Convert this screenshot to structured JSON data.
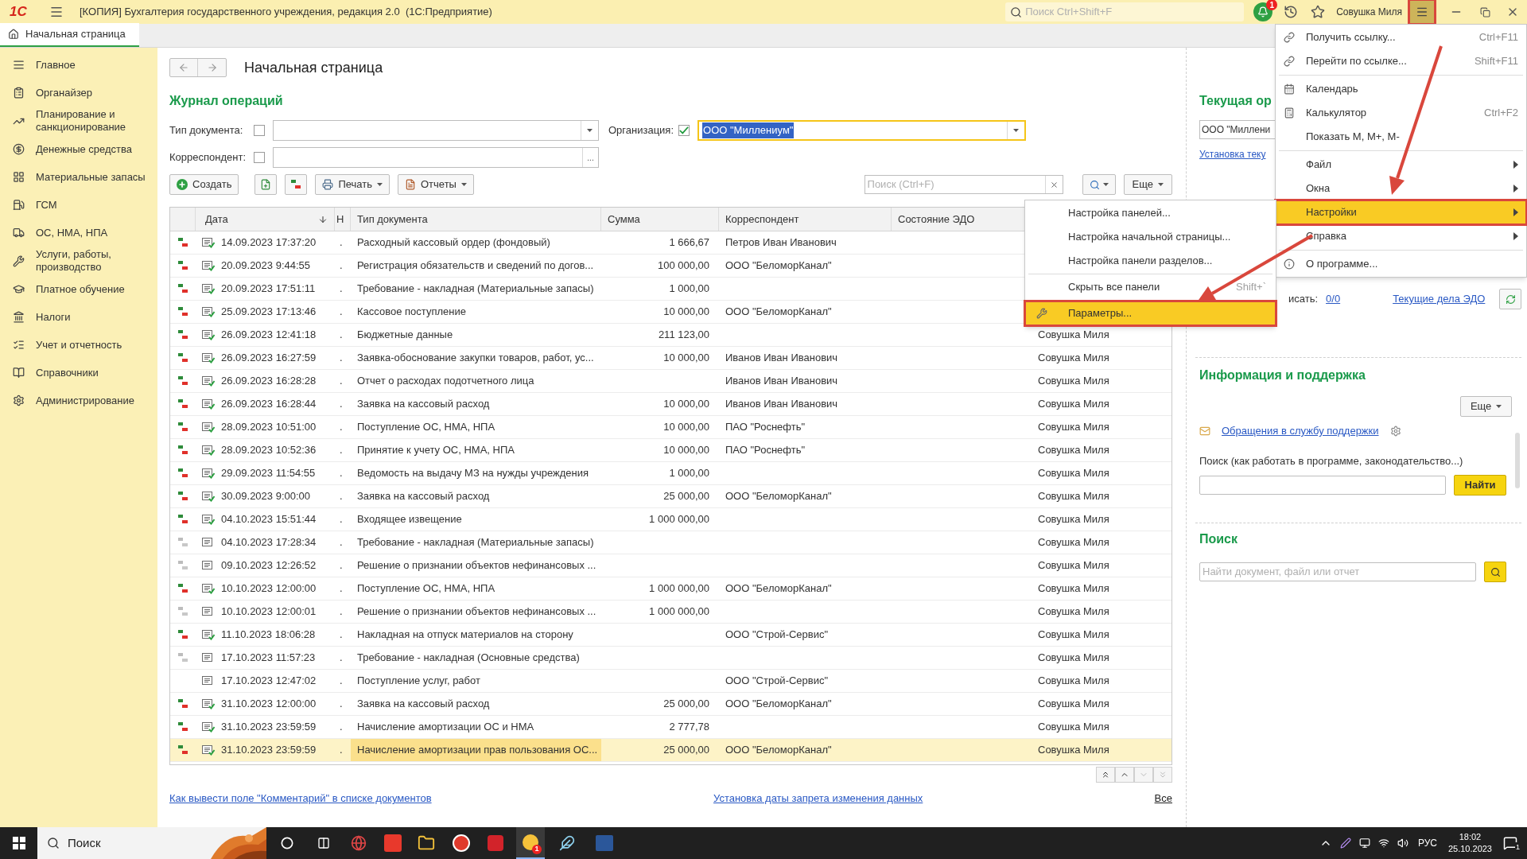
{
  "title_bar": {
    "logo": "1С",
    "title": "[КОПИЯ] Бухгалтерия государственного учреждения, редакция 2.0  (1С:Предприятие)",
    "search_placeholder": "Поиск Ctrl+Shift+F",
    "notifications": "1",
    "user": "Совушка Миля",
    "menu_highlighted": true
  },
  "tabs": [
    {
      "label": "Начальная страница",
      "selected": true
    }
  ],
  "sidebar": {
    "items": [
      {
        "label": "Главное"
      },
      {
        "label": "Органайзер"
      },
      {
        "label": "Планирование и санкционирование"
      },
      {
        "label": "Денежные средства"
      },
      {
        "label": "Материальные запасы"
      },
      {
        "label": "ГСМ"
      },
      {
        "label": "ОС, НМА, НПА"
      },
      {
        "label": "Услуги, работы, производство"
      },
      {
        "label": "Платное обучение"
      },
      {
        "label": "Налоги"
      },
      {
        "label": "Учет и отчетность"
      },
      {
        "label": "Справочники"
      },
      {
        "label": "Администрирование"
      }
    ]
  },
  "page": {
    "title": "Начальная страница"
  },
  "journal": {
    "title": "Журнал операций",
    "filters": [
      {
        "label": "Тип документа:",
        "checked": false,
        "kind": "combo"
      },
      {
        "label": "Организация:",
        "checked": true,
        "value": "ООО \"Миллениум\"",
        "kind": "combo"
      },
      {
        "label": "Корреспондент:",
        "checked": false,
        "kind": "choice",
        "button": "..."
      }
    ],
    "toolbar": {
      "create": "Создать",
      "print": "Печать",
      "reports": "Отчеты",
      "search_placeholder": "Поиск (Ctrl+F)",
      "more": "Еще"
    },
    "table": {
      "columns": [
        "Дата",
        "Н",
        "Тип документа",
        "Сумма",
        "Корреспондент",
        "Состояние ЭДО"
      ],
      "rows": [
        {
          "kind": "posted",
          "date": "14.09.2023 17:37:20",
          "n": ".",
          "type": "Расходный кассовый ордер (фондовый)",
          "sum": "1 666,67",
          "correspondent": "Петров Иван Иванович",
          "selected": false
        },
        {
          "kind": "posted",
          "date": "20.09.2023 9:44:55",
          "n": ".",
          "type": "Регистрация обязательств и сведений по догов...",
          "sum": "100 000,00",
          "correspondent": "ООО \"БеломорКанал\"",
          "selected": false
        },
        {
          "kind": "posted",
          "date": "20.09.2023 17:51:11",
          "n": ".",
          "type": "Требование - накладная (Материальные запасы)",
          "sum": "1 000,00",
          "selected": false
        },
        {
          "kind": "posted",
          "date": "25.09.2023 17:13:46",
          "n": ".",
          "type": "Кассовое поступление",
          "sum": "10 000,00",
          "correspondent": "ООО \"БеломорКанал\"",
          "selected": false
        },
        {
          "kind": "posted",
          "date": "26.09.2023 12:41:18",
          "n": ".",
          "type": "Бюджетные данные",
          "sum": "211 123,00",
          "responsible": "Совушка Миля",
          "selected": false
        },
        {
          "kind": "posted",
          "date": "26.09.2023 16:27:59",
          "n": ".",
          "type": "Заявка-обоснование закупки товаров, работ, ус...",
          "sum": "10 000,00",
          "correspondent": "Иванов Иван Иванович",
          "responsible": "Совушка Миля",
          "selected": false
        },
        {
          "kind": "posted",
          "date": "26.09.2023 16:28:28",
          "n": ".",
          "type": "Отчет о расходах подотчетного лица",
          "correspondent": "Иванов Иван Иванович",
          "responsible": "Совушка Миля",
          "selected": false
        },
        {
          "kind": "posted",
          "date": "26.09.2023 16:28:44",
          "n": ".",
          "type": "Заявка на кассовый расход",
          "sum": "10 000,00",
          "correspondent": "Иванов Иван Иванович",
          "responsible": "Совушка Миля",
          "selected": false
        },
        {
          "kind": "posted",
          "date": "28.09.2023 10:51:00",
          "n": ".",
          "type": "Поступление ОС, НМА, НПА",
          "sum": "10 000,00",
          "correspondent": "ПАО \"Роснефть\"",
          "responsible": "Совушка Миля",
          "selected": false
        },
        {
          "kind": "posted",
          "date": "28.09.2023 10:52:36",
          "n": ".",
          "type": "Принятие к учету ОС, НМА, НПА",
          "sum": "10 000,00",
          "correspondent": "ПАО \"Роснефть\"",
          "responsible": "Совушка Миля",
          "selected": false
        },
        {
          "kind": "posted",
          "date": "29.09.2023 11:54:55",
          "n": ".",
          "type": "Ведомость на выдачу МЗ на нужды учреждения",
          "sum": "1 000,00",
          "responsible": "Совушка Миля",
          "selected": false
        },
        {
          "kind": "posted",
          "date": "30.09.2023 9:00:00",
          "n": ".",
          "type": "Заявка на кассовый расход",
          "sum": "25 000,00",
          "correspondent": "ООО \"БеломорКанал\"",
          "responsible": "Совушка Миля",
          "selected": false
        },
        {
          "kind": "posted",
          "date": "04.10.2023 15:51:44",
          "n": ".",
          "type": "Входящее извещение",
          "sum": "1 000 000,00",
          "responsible": "Совушка Миля",
          "selected": false
        },
        {
          "kind": "unposted",
          "date": "04.10.2023 17:28:34",
          "n": ".",
          "type": "Требование - накладная (Материальные запасы)",
          "responsible": "Совушка Миля",
          "selected": false
        },
        {
          "kind": "unposted",
          "date": "09.10.2023 12:26:52",
          "n": ".",
          "type": "Решение о признании объектов нефинансовых ...",
          "responsible": "Совушка Миля",
          "selected": false
        },
        {
          "kind": "posted",
          "date": "10.10.2023 12:00:00",
          "n": ".",
          "type": "Поступление ОС, НМА, НПА",
          "sum": "1 000 000,00",
          "correspondent": "ООО \"БеломорКанал\"",
          "responsible": "Совушка Миля",
          "selected": false
        },
        {
          "kind": "unposted",
          "date": "10.10.2023 12:00:01",
          "n": ".",
          "type": "Решение о признании объектов нефинансовых ...",
          "sum": "1 000 000,00",
          "responsible": "Совушка Миля",
          "selected": false
        },
        {
          "kind": "posted",
          "date": "11.10.2023 18:06:28",
          "n": ".",
          "type": "Накладная на отпуск материалов на сторону",
          "correspondent": "ООО \"Строй-Сервис\"",
          "responsible": "Совушка Миля",
          "selected": false
        },
        {
          "kind": "unposted",
          "date": "17.10.2023 11:57:23",
          "n": ".",
          "type": "Требование - накладная (Основные средства)",
          "responsible": "Совушка Миля",
          "selected": false
        },
        {
          "kind": "none",
          "date": "17.10.2023 12:47:02",
          "n": ".",
          "type": "Поступление услуг, работ",
          "correspondent": "ООО \"Строй-Сервис\"",
          "responsible": "Совушка Миля",
          "selected": false
        },
        {
          "kind": "posted",
          "date": "31.10.2023 12:00:00",
          "n": ".",
          "type": "Заявка на кассовый расход",
          "sum": "25 000,00",
          "correspondent": "ООО \"БеломорКанал\"",
          "responsible": "Совушка Миля",
          "selected": false
        },
        {
          "kind": "posted",
          "date": "31.10.2023 23:59:59",
          "n": ".",
          "type": "Начисление амортизации ОС и НМА",
          "sum": "2 777,78",
          "responsible": "Совушка Миля",
          "selected": false
        },
        {
          "kind": "posted",
          "date": "31.10.2023 23:59:59",
          "n": ".",
          "type": "Начисление амортизации прав пользования ОС...",
          "sum": "25 000,00",
          "correspondent": "ООО \"БеломорКанал\"",
          "responsible": "Совушка Миля",
          "selected": true
        }
      ]
    },
    "links": [
      "Как вывести поле \"Комментарий\" в списке документов",
      "Установка даты запрета изменения данных",
      "Все"
    ]
  },
  "right_panel": {
    "org_title": "Текущая ор",
    "org_value": "ООО \"Миллени",
    "org_link": "Установка теку",
    "sign_label": "исать:",
    "sign_count": "0/0",
    "edo_link": "Текущие дела ЭДО",
    "support_title": "Информация и поддержка",
    "more": "Еще",
    "support_link": "Обращения в службу поддержки",
    "help_label": "Поиск (как работать в программе, законодательство...)",
    "find": "Найти",
    "search_title": "Поиск",
    "search_placeholder": "Найти документ, файл или отчет"
  },
  "main_menu": {
    "items": [
      {
        "kind": "item",
        "label": "Получить ссылку...",
        "shortcut": "Ctrl+F11",
        "selected": false
      },
      {
        "kind": "item",
        "label": "Перейти по ссылке...",
        "shortcut": "Shift+F11",
        "selected": false
      },
      {
        "kind": "separator"
      },
      {
        "kind": "item",
        "label": "Календарь",
        "selected": false
      },
      {
        "kind": "item",
        "label": "Калькулятор",
        "shortcut": "Ctrl+F2",
        "selected": false
      },
      {
        "kind": "item",
        "label": "Показать М, М+, М-",
        "selected": false
      },
      {
        "kind": "separator"
      },
      {
        "kind": "submenu",
        "label": "Файл",
        "selected": false
      },
      {
        "kind": "submenu",
        "label": "Окна",
        "selected": false
      },
      {
        "kind": "submenu",
        "label": "Настройки",
        "selected": true,
        "highlighted": true
      },
      {
        "kind": "submenu",
        "label": "Справка",
        "selected": false
      },
      {
        "kind": "separator"
      },
      {
        "kind": "item",
        "label": "О программе...",
        "selected": false
      }
    ]
  },
  "submenu": {
    "items": [
      {
        "kind": "item",
        "label": "Настройка панелей...",
        "selected": false
      },
      {
        "kind": "item",
        "label": "Настройка начальной страницы...",
        "selected": false
      },
      {
        "kind": "item",
        "label": "Настройка панели разделов...",
        "selected": false
      },
      {
        "kind": "separator"
      },
      {
        "kind": "item",
        "label": "Скрыть все панели",
        "shortcut": "Shift+`",
        "selected": false
      },
      {
        "kind": "separator"
      },
      {
        "kind": "item",
        "label": "Параметры...",
        "selected": true,
        "highlighted": true
      }
    ]
  },
  "taskbar": {
    "search": "Поиск",
    "app_badge": "1",
    "language": "РУС",
    "time": "18:02",
    "date": "25.10.2023",
    "notification_badge": "1"
  }
}
